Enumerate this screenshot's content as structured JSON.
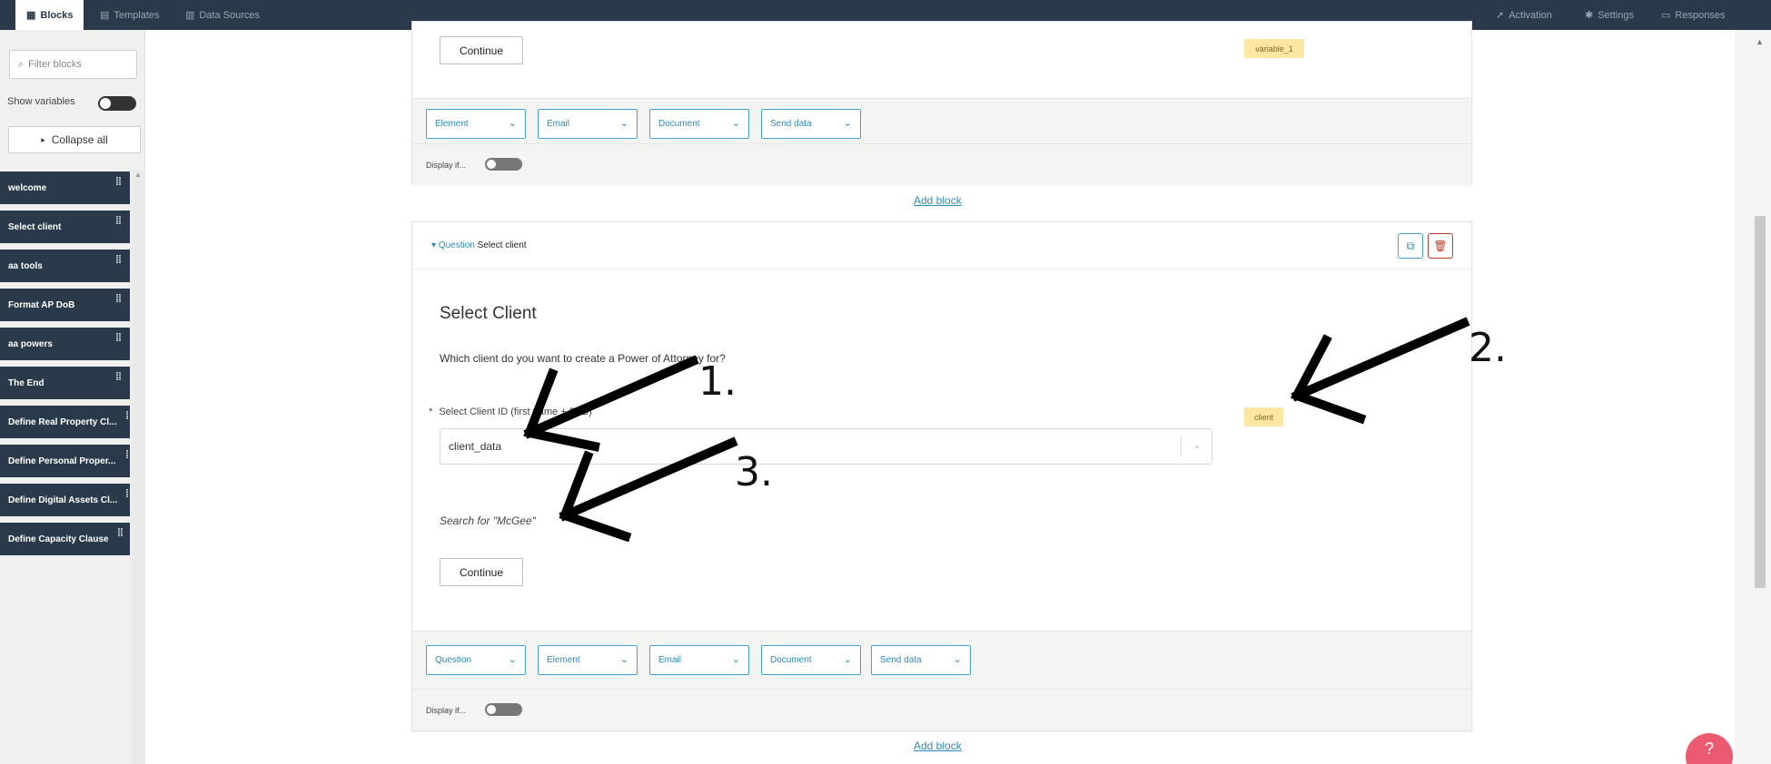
{
  "topbar": {
    "tabs": [
      {
        "label": "Blocks",
        "icon": "grid-icon"
      },
      {
        "label": "Templates",
        "icon": "document-icon"
      },
      {
        "label": "Data Sources",
        "icon": "database-icon"
      }
    ],
    "right_links": [
      {
        "label": "Activation",
        "icon": "rocket-icon"
      },
      {
        "label": "Settings",
        "icon": "gear-icon"
      },
      {
        "label": "Responses",
        "icon": "inbox-icon"
      }
    ]
  },
  "sidebar": {
    "filter_placeholder": "Filter blocks",
    "show_variables_label": "Show variables",
    "collapse_label": "Collapse all",
    "blocks": [
      "welcome",
      "Select client",
      "aa tools",
      "Format AP DoB",
      "aa powers",
      "The End",
      "Define Real Property Cl...",
      "Define Personal Proper...",
      "Define Digital Assets Cl...",
      "Define Capacity Clause"
    ]
  },
  "card1": {
    "continue_label": "Continue",
    "variable_badge": "variable_1",
    "action_dropdowns": [
      "Element",
      "Email",
      "Document",
      "Send data"
    ],
    "display_if_label": "Display if..."
  },
  "add_block_label": "Add block",
  "card2": {
    "breadcrumb_type": "Question",
    "breadcrumb_name": "Select client",
    "title": "Select Client",
    "question_text": "Which client do you want to create a Power of Attorney for?",
    "field_label": "Select Client ID (first name + DoB)",
    "required_mark": "*",
    "select_value": "client_data",
    "variable_badge": "client",
    "hint": "Search for \"McGee\"",
    "continue_label": "Continue",
    "action_dropdowns": [
      "Question",
      "Element",
      "Email",
      "Document",
      "Send data"
    ],
    "display_if_label": "Display if..."
  },
  "annotations": {
    "callouts": [
      "1.",
      "2.",
      "3."
    ]
  },
  "help_icon": "help-icon"
}
